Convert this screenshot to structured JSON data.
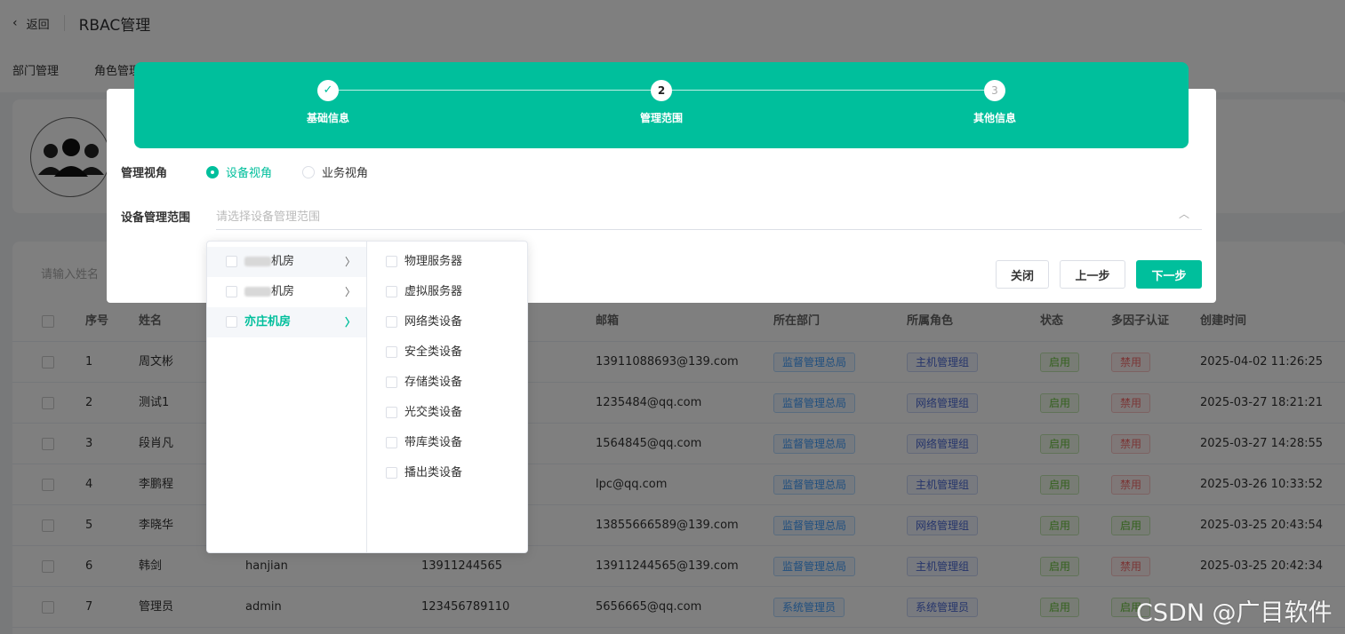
{
  "header": {
    "back_label": "返回",
    "title": "RBAC管理"
  },
  "nav_tabs": [
    "部门管理",
    "角色管理"
  ],
  "table": {
    "search_placeholder": "请输入姓名",
    "columns": [
      "序号",
      "姓名",
      "",
      "",
      "邮箱",
      "所在部门",
      "所属角色",
      "状态",
      "多因子认证",
      "创建时间"
    ],
    "rows": [
      {
        "no": "1",
        "name": "周文彬",
        "username": "",
        "phone": "",
        "email": "13911088693@139.com",
        "dept": "监督管理总局",
        "role": "主机管理组",
        "status": "启用",
        "mfa": "禁用",
        "created": "2025-04-02 11:26:25"
      },
      {
        "no": "2",
        "name": "测试1",
        "username": "",
        "phone": "",
        "email": "1235484@qq.com",
        "dept": "监督管理总局",
        "role": "网络管理组",
        "status": "启用",
        "mfa": "禁用",
        "created": "2025-03-27 18:21:21"
      },
      {
        "no": "3",
        "name": "段肖凡",
        "username": "",
        "phone": "",
        "email": "1564845@qq.com",
        "dept": "监督管理总局",
        "role": "网络管理组",
        "status": "启用",
        "mfa": "禁用",
        "created": "2025-03-27 14:28:55"
      },
      {
        "no": "4",
        "name": "李鹏程",
        "username": "",
        "phone": "",
        "email": "lpc@qq.com",
        "dept": "监督管理总局",
        "role": "主机管理组",
        "status": "启用",
        "mfa": "禁用",
        "created": "2025-03-26 10:33:52"
      },
      {
        "no": "5",
        "name": "李晓华",
        "username": "",
        "phone": "",
        "email": "13855666589@139.com",
        "dept": "监督管理总局",
        "role": "网络管理组",
        "status": "启用",
        "mfa": "启用",
        "created": "2025-03-25 20:43:54"
      },
      {
        "no": "6",
        "name": "韩剑",
        "username": "hanjian",
        "phone": "13911244565",
        "email": "13911244565@139.com",
        "dept": "监督管理总局",
        "role": "主机管理组",
        "status": "启用",
        "mfa": "禁用",
        "created": "2025-03-25 20:42:34"
      },
      {
        "no": "7",
        "name": "管理员",
        "username": "admin",
        "phone": "123456789110",
        "email": "5656665@qq.com",
        "dept": "系统管理员",
        "role": "系统管理员",
        "status": "启用",
        "mfa": "启用",
        "created": ""
      }
    ]
  },
  "dialog": {
    "steps": [
      {
        "number": "",
        "label": "基础信息",
        "state": "done"
      },
      {
        "number": "2",
        "label": "管理范围",
        "state": "active"
      },
      {
        "number": "3",
        "label": "其他信息",
        "state": "pending"
      }
    ],
    "view_label": "管理视角",
    "view_options": [
      "设备视角",
      "业务视角"
    ],
    "scope_label": "设备管理范围",
    "scope_placeholder": "请选择设备管理范围",
    "buttons": {
      "close": "关闭",
      "prev": "上一步",
      "next": "下一步"
    }
  },
  "cascader": {
    "locations": [
      "机房",
      "机房",
      "亦庄机房"
    ],
    "device_types": [
      "物理服务器",
      "虚拟服务器",
      "网络类设备",
      "安全类设备",
      "存储类设备",
      "光交类设备",
      "带库类设备",
      "播出类设备"
    ]
  },
  "watermark": "CSDN @广目软件",
  "colors": {
    "primary": "#00bf9c",
    "enabled": "#67c23a",
    "disabled": "#f56c6c"
  },
  "icons": [
    "chevron-left-icon",
    "user-group-icon",
    "check-icon",
    "chevron-up-icon",
    "chevron-right-icon"
  ]
}
